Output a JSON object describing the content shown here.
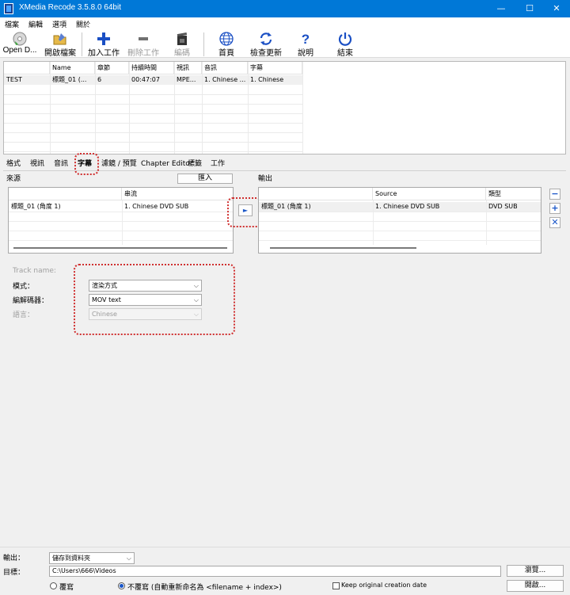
{
  "window": {
    "title": "XMedia Recode 3.5.8.0 64bit",
    "min": "—",
    "max": "☐",
    "close": "✕"
  },
  "menu": [
    "檔案",
    "編輯",
    "選項",
    "關於"
  ],
  "toolbar": [
    {
      "label": "Open D...",
      "icon": "disc-icon",
      "enabled": true
    },
    {
      "label": "開啟檔案",
      "icon": "open-file-icon",
      "enabled": true
    },
    {
      "label": "加入工作",
      "icon": "plus-icon",
      "enabled": true
    },
    {
      "label": "刪除工作",
      "icon": "minus-icon",
      "enabled": false
    },
    {
      "label": "編碼",
      "icon": "film-icon",
      "enabled": false
    },
    {
      "label": "首頁",
      "icon": "globe-icon",
      "enabled": true
    },
    {
      "label": "檢查更新",
      "icon": "refresh-icon",
      "enabled": true
    },
    {
      "label": "說明",
      "icon": "help-icon",
      "enabled": true
    },
    {
      "label": "結束",
      "icon": "power-icon",
      "enabled": true
    }
  ],
  "jobs": {
    "columns": [
      "Name",
      "章節",
      "持續時間",
      "視訊",
      "音訊",
      "字幕"
    ],
    "rows": [
      {
        "row_header": "TEST",
        "cells": [
          "標題_01 (...",
          "6",
          "00:47:07",
          "MPE...",
          "1. Chinese ...",
          "1. Chinese"
        ]
      }
    ]
  },
  "tabs": [
    "格式",
    "視訊",
    "音訊",
    "字幕",
    "濾鏡 / 預覽",
    "Chapter Editor",
    "標籤",
    "工作"
  ],
  "active_tab": "字幕",
  "source": {
    "label": "來源",
    "import_button": "匯入",
    "column": "串流",
    "rows": [
      {
        "name": "標題_01 (角度 1)",
        "stream": "1. Chinese DVD SUB"
      }
    ]
  },
  "add_arrow": "►",
  "output_panel": {
    "label": "輸出",
    "columns": [
      "Source",
      "類型"
    ],
    "rows": [
      {
        "name": "標題_01 (角度 1)",
        "source": "1. Chinese DVD SUB",
        "type": "DVD SUB"
      }
    ]
  },
  "side_buttons": [
    "−",
    "+",
    "✕"
  ],
  "settings": {
    "track_name_label": "Track name:",
    "mode_label": "模式：",
    "mode_value": "渲染方式",
    "codec_label": "編解碼器：",
    "codec_value": "MOV text",
    "language_label": "語言：",
    "language_value": "Chinese"
  },
  "bottom": {
    "output_label": "輸出：",
    "output_value": "儲存到資料夾",
    "target_label": "目標：",
    "target_path": "C:\\Users\\666\\Videos",
    "browse_button": "瀏覽...",
    "open_button": "開啟...",
    "overwrite_label": "覆寫",
    "no_overwrite_label": "不覆寫 (自動重新命名為 <filename + index>)",
    "keep_date_label": "Keep original creation date"
  },
  "colors": {
    "titlebar": "#0078d7",
    "highlight": "#d03030",
    "accent": "#1a56c8"
  }
}
